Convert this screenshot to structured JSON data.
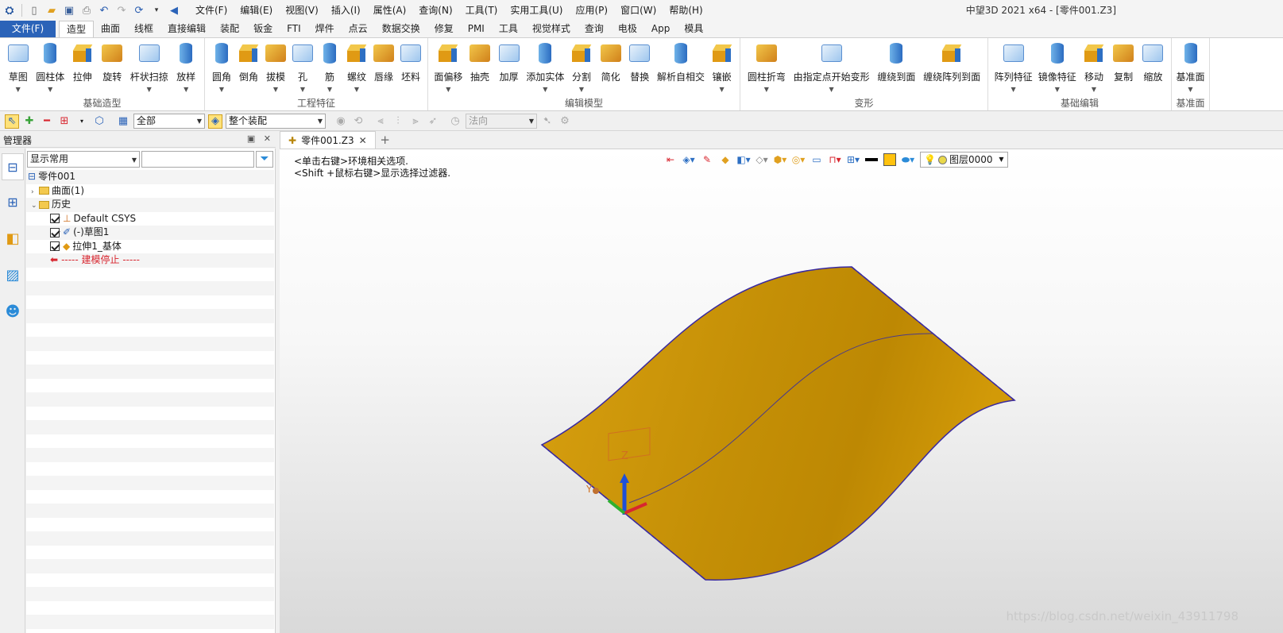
{
  "title_bar": {
    "app_title": "中望3D 2021 x64 - [零件001.Z3]",
    "quick_access_icons": [
      "new-file-icon",
      "open-file-icon",
      "save-icon",
      "print-icon",
      "undo-icon",
      "redo-icon",
      "regen-icon",
      "customize-icon",
      "back-icon"
    ]
  },
  "menu": [
    "文件(F)",
    "编辑(E)",
    "视图(V)",
    "插入(I)",
    "属性(A)",
    "查询(N)",
    "工具(T)",
    "实用工具(U)",
    "应用(P)",
    "窗口(W)",
    "帮助(H)"
  ],
  "ribbon_tabs": {
    "file_tab": "文件(F)",
    "tabs": [
      "造型",
      "曲面",
      "线框",
      "直接编辑",
      "装配",
      "钣金",
      "FTI",
      "焊件",
      "点云",
      "数据交换",
      "修复",
      "PMI",
      "工具",
      "视觉样式",
      "查询",
      "电极",
      "App",
      "模具"
    ],
    "active": "造型"
  },
  "ribbon_groups": [
    {
      "title": "基础造型",
      "buttons": [
        {
          "label": "草图",
          "icon": "sketch-icon",
          "dropdown": true
        },
        {
          "label": "圆柱体",
          "icon": "cylinder-icon",
          "dropdown": true
        },
        {
          "label": "拉伸",
          "icon": "extrude-icon",
          "dropdown": false
        },
        {
          "label": "旋转",
          "icon": "revolve-icon",
          "dropdown": false
        },
        {
          "label": "杆状扫掠",
          "icon": "rod-sweep-icon",
          "dropdown": true
        },
        {
          "label": "放样",
          "icon": "loft-icon",
          "dropdown": true
        }
      ]
    },
    {
      "title": "工程特征",
      "buttons": [
        {
          "label": "圆角",
          "icon": "fillet-icon",
          "dropdown": true
        },
        {
          "label": "倒角",
          "icon": "chamfer-icon",
          "dropdown": false
        },
        {
          "label": "拔模",
          "icon": "draft-icon",
          "dropdown": true
        },
        {
          "label": "孔",
          "icon": "hole-icon",
          "dropdown": true
        },
        {
          "label": "筋",
          "icon": "rib-icon",
          "dropdown": true
        },
        {
          "label": "螺纹",
          "icon": "thread-icon",
          "dropdown": true
        },
        {
          "label": "唇缘",
          "icon": "lip-icon",
          "dropdown": false
        },
        {
          "label": "坯料",
          "icon": "stock-icon",
          "dropdown": false
        }
      ]
    },
    {
      "title": "编辑模型",
      "buttons": [
        {
          "label": "面偏移",
          "icon": "face-offset-icon",
          "dropdown": true
        },
        {
          "label": "抽壳",
          "icon": "shell-icon",
          "dropdown": false
        },
        {
          "label": "加厚",
          "icon": "thicken-icon",
          "dropdown": false
        },
        {
          "label": "添加实体",
          "icon": "add-solid-icon",
          "dropdown": true
        },
        {
          "label": "分割",
          "icon": "split-icon",
          "dropdown": true
        },
        {
          "label": "简化",
          "icon": "simplify-icon",
          "dropdown": false
        },
        {
          "label": "替换",
          "icon": "replace-icon",
          "dropdown": false
        },
        {
          "label": "解析自相交",
          "icon": "self-intersect-icon",
          "dropdown": false
        },
        {
          "label": "镶嵌",
          "icon": "emboss-icon",
          "dropdown": true
        }
      ]
    },
    {
      "title": "变形",
      "buttons": [
        {
          "label": "圆柱折弯",
          "icon": "cylinder-bend-icon",
          "dropdown": true
        },
        {
          "label": "由指定点开始变形",
          "icon": "point-deform-icon",
          "dropdown": true
        },
        {
          "label": "缠绕到面",
          "icon": "wrap-to-face-icon",
          "dropdown": false
        },
        {
          "label": "缠绕阵列到面",
          "icon": "wrap-pattern-icon",
          "dropdown": false
        }
      ]
    },
    {
      "title": "基础编辑",
      "buttons": [
        {
          "label": "阵列特征",
          "icon": "pattern-icon",
          "dropdown": true
        },
        {
          "label": "镜像特征",
          "icon": "mirror-icon",
          "dropdown": true
        },
        {
          "label": "移动",
          "icon": "move-icon",
          "dropdown": true
        },
        {
          "label": "复制",
          "icon": "copy-icon",
          "dropdown": false
        },
        {
          "label": "缩放",
          "icon": "scale-icon",
          "dropdown": false
        }
      ]
    },
    {
      "title": "基准面",
      "buttons": [
        {
          "label": "基准面",
          "icon": "datum-plane-icon",
          "dropdown": true
        }
      ]
    }
  ],
  "selection_toolbar": {
    "filter_value": "全部",
    "scope_value": "整个装配",
    "direction_placeholder": "法向"
  },
  "manager": {
    "title": "管理器",
    "filter_value": "显示常用",
    "search_value": "",
    "tree": [
      {
        "label": "零件001",
        "level": 0,
        "expander": "",
        "type": "part"
      },
      {
        "label": "曲面(1)",
        "level": 1,
        "expander": ">",
        "type": "folder"
      },
      {
        "label": "历史",
        "level": 1,
        "expander": "v",
        "type": "folder"
      },
      {
        "label": "Default CSYS",
        "level": 2,
        "expander": "",
        "type": "csys",
        "checked": true
      },
      {
        "label": "(-)草图1",
        "level": 2,
        "expander": "",
        "type": "sketch",
        "checked": true
      },
      {
        "label": "拉伸1_基体",
        "level": 2,
        "expander": "",
        "type": "extrude",
        "checked": true
      },
      {
        "label": "----- 建模停止 -----",
        "level": 2,
        "expander": "",
        "type": "stop"
      }
    ]
  },
  "document": {
    "tab_label": "零件001.Z3",
    "hints": [
      "<单击右键>环境相关选项.",
      "<Shift +鼠标右键>显示选择过滤器."
    ],
    "layer_value": "图层0000",
    "watermark": "https://blog.csdn.net/weixin_43911798",
    "axis_label_z": "Z",
    "axis_label_y": "Y",
    "surface_color": "#d99f0b",
    "edge_color": "#3a2aa0"
  }
}
